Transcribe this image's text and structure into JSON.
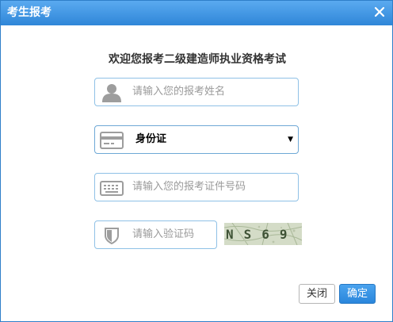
{
  "dialog": {
    "title": "考生报考",
    "heading": "欢迎您报考二级建造师执业资格考试"
  },
  "form": {
    "name": {
      "placeholder": "请输入您的报考姓名",
      "icon": "user-icon"
    },
    "id_type": {
      "selected": "身份证",
      "icon": "id-card-icon"
    },
    "id_number": {
      "placeholder": "请输入您的报考证件号码",
      "icon": "keyboard-icon"
    },
    "verify": {
      "placeholder": "请输入验证码",
      "icon": "shield-icon"
    },
    "captcha": {
      "text": "NS69"
    }
  },
  "buttons": {
    "cancel": "关闭",
    "ok": "确定"
  },
  "colors": {
    "titlebar": "#3b8fdc",
    "field_border": "#8fc1e6",
    "ok_button": "#2a86dc"
  }
}
